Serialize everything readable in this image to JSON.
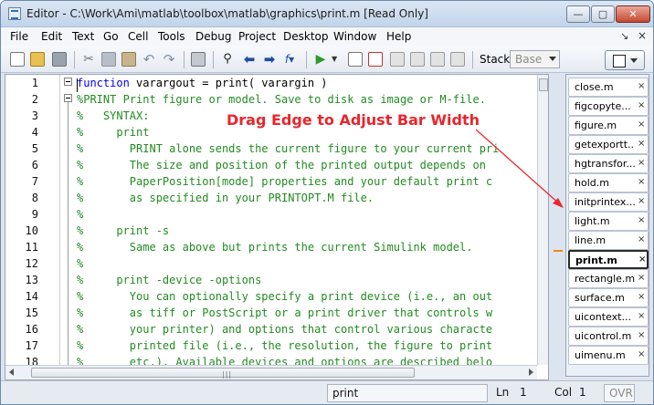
{
  "window": {
    "title": "Editor - C:\\Work\\Ami\\matlab\\toolbox\\matlab\\graphics\\print.m [Read Only]",
    "min_glyph": "—",
    "max_glyph": "▢",
    "close_glyph": "✕"
  },
  "menu": [
    "File",
    "Edit",
    "Text",
    "Go",
    "Cell",
    "Tools",
    "Debug",
    "Project",
    "Desktop",
    "Window",
    "Help"
  ],
  "menu_pin": "↘",
  "menu_close": "×",
  "toolbar": {
    "icons": [
      "new-file-icon",
      "open-folder-icon",
      "save-icon",
      "cut-icon",
      "copy-icon",
      "paste-icon",
      "undo-icon",
      "redo-icon",
      "print-icon",
      "find-icon",
      "back-icon",
      "forward-icon",
      "function-icon",
      "run-icon",
      "breakpoint-icon",
      "clear-breakpoint-icon",
      "step-icon",
      "step-in-icon",
      "step-out-icon",
      "continue-icon",
      "exit-debug-icon"
    ],
    "stack_label": "Stack:",
    "stack_value": "Base"
  },
  "editor": {
    "line_numbers": [
      "1",
      "2",
      "3",
      "4",
      "5",
      "6",
      "7",
      "8",
      "9",
      "10",
      "11",
      "12",
      "13",
      "14",
      "15",
      "16",
      "17",
      "18"
    ],
    "lines": [
      {
        "kw": "function",
        "rest": " varargout = print( varargin )"
      },
      {
        "kw": "",
        "rest": "%PRINT Print figure or model. Save to disk as image or M-file."
      },
      {
        "kw": "",
        "rest": "%   SYNTAX:"
      },
      {
        "kw": "",
        "rest": "%     print"
      },
      {
        "kw": "",
        "rest": "%       PRINT alone sends the current figure to your current pri"
      },
      {
        "kw": "",
        "rest": "%       The size and position of the printed output depends on"
      },
      {
        "kw": "",
        "rest": "%       PaperPosition[mode] properties and your default print c"
      },
      {
        "kw": "",
        "rest": "%       as specified in your PRINTOPT.M file."
      },
      {
        "kw": "",
        "rest": "%"
      },
      {
        "kw": "",
        "rest": "%     print -s"
      },
      {
        "kw": "",
        "rest": "%       Same as above but prints the current Simulink model."
      },
      {
        "kw": "",
        "rest": "%"
      },
      {
        "kw": "",
        "rest": "%     print -device -options"
      },
      {
        "kw": "",
        "rest": "%       You can optionally specify a print device (i.e., an out"
      },
      {
        "kw": "",
        "rest": "%       as tiff or PostScript or a print driver that controls w"
      },
      {
        "kw": "",
        "rest": "%       your printer) and options that control various characte"
      },
      {
        "kw": "",
        "rest": "%       printed file (i.e., the resolution, the figure to print"
      },
      {
        "kw": "",
        "rest": "%       etc.). Available devices and options are described belo"
      }
    ]
  },
  "scroll_grip": "|||",
  "annotation": "Drag Edge to Adjust Bar Width",
  "tabs": [
    {
      "label": "close.m",
      "active": false
    },
    {
      "label": "figcopyte...",
      "active": false
    },
    {
      "label": "figure.m",
      "active": false
    },
    {
      "label": "getexportt...",
      "active": false
    },
    {
      "label": "hgtransfor...",
      "active": false
    },
    {
      "label": "hold.m",
      "active": false
    },
    {
      "label": "initprintex...",
      "active": false
    },
    {
      "label": "light.m",
      "active": false
    },
    {
      "label": "line.m",
      "active": false
    },
    {
      "label": "print.m",
      "active": true
    },
    {
      "label": "rectangle.m",
      "active": false
    },
    {
      "label": "surface.m",
      "active": false
    },
    {
      "label": "uicontext...",
      "active": false
    },
    {
      "label": "uicontrol.m",
      "active": false
    },
    {
      "label": "uimenu.m",
      "active": false
    }
  ],
  "tab_close_glyph": "×",
  "status": {
    "function": "print",
    "ln_label": "Ln",
    "ln_value": "1",
    "col_label": "Col",
    "col_value": "1",
    "ovr": "OVR"
  },
  "colors": {
    "annotation": "#e8262c",
    "comment": "#228b22",
    "keyword": "#0000ff"
  }
}
